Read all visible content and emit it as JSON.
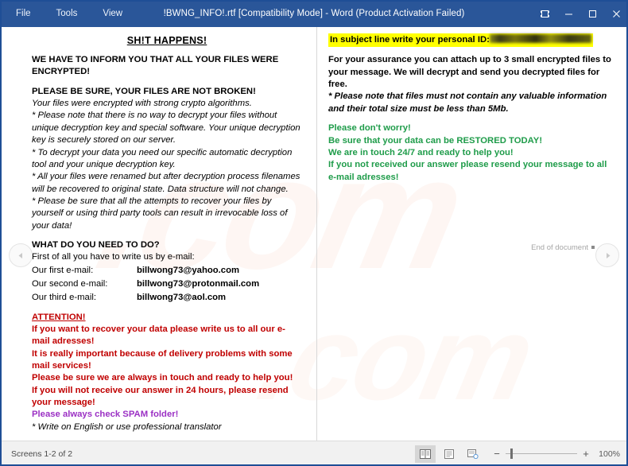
{
  "titlebar": {
    "menu": [
      {
        "label": "File",
        "name": "menu-file"
      },
      {
        "label": "Tools",
        "name": "menu-tools"
      },
      {
        "label": "View",
        "name": "menu-view"
      }
    ],
    "title": "!BWNG_INFO!.rtf [Compatibility Mode] - Word (Product Activation Failed)",
    "controls": {
      "ribbon_options": "ribbon-display-options",
      "minimize": "minimize",
      "maximize": "maximize",
      "close": "close"
    },
    "background_color": "#2a5699"
  },
  "document": {
    "left_page": {
      "heading": "SH!T HAPPENS!",
      "line_inform": "WE HAVE TO INFORM YOU THAT ALL YOUR FILES WERE ENCRYPTED!",
      "line_not_broken": "PLEASE BE SURE, YOUR FILES ARE NOT BROKEN!",
      "para_strong_crypto": "Your files were encrypted with strong crypto algorithms.",
      "para_no_way": "* Please note that there is no way to decrypt your files without unique decryption key and special software. Your unique decryption key is securely stored on our server.",
      "para_tool": "* To decrypt your data you need our specific automatic decryption tool and your unique decryption key.",
      "para_renamed": "* All your files were renamed but after decryption process filenames will be recovered to original state. Data structure will not change.",
      "para_third_party": "* Please be sure that all the attempts to recover your files by yourself or using third party tools can result in irrevocable loss of your data!",
      "what_do_you_need": "WHAT DO YOU NEED TO DO?",
      "first_of_all": "First of all you have to write us by e-mail:",
      "emails": [
        {
          "label": "Our first e-mail:",
          "value": "billwong73@yahoo.com"
        },
        {
          "label": "Our second e-mail:",
          "value": "billwong73@protonmail.com"
        },
        {
          "label": "Our third e-mail:",
          "value": "billwong73@aol.com"
        }
      ],
      "attention_heading": "ATTENTION!",
      "attention_lines": [
        "If you want to recover your data please write us to all our e-mail adresses!",
        "It is really important because of delivery problems with some mail services!",
        "Please be sure we are always in touch and ready to help you!",
        "If you will not receive our answer in 24 hours, please resend your message!"
      ],
      "spam_line": "Please always check SPAM folder!",
      "translator_line": "* Write on English or use professional translator"
    },
    "right_page": {
      "subject_line_label": "In subject line write your personal ID:",
      "personal_id": "",
      "assurance_para": "For your assurance you can attach up to 3 small encrypted files to your message. We will decrypt and send you decrypted files for free.",
      "note_para": "*      Please note that files must not contain any valuable information and their total size must be less than 5Mb.",
      "green_lines": [
        "Please don't worry!",
        "Be sure that your data can be RESTORED TODAY!",
        "We are in touch 24/7 and ready to help you!",
        "If you not received our answer please resend your message to all e-mail adresses!"
      ],
      "end_of_document": "End of document"
    },
    "watermark_text": ".com",
    "colors": {
      "red": "#c00000",
      "green": "#1f9c4a",
      "purple": "#9b30c4",
      "highlight": "#ffff00"
    }
  },
  "navigation": {
    "previous": "previous-page",
    "next": "next-page"
  },
  "statusbar": {
    "screens_label": "Screens 1-2 of 2",
    "views": [
      {
        "name": "read-mode-view",
        "active": true
      },
      {
        "name": "print-layout-view",
        "active": false
      },
      {
        "name": "web-layout-view",
        "active": false
      }
    ],
    "zoom_out": "−",
    "zoom_in": "+",
    "zoom_level": "100%"
  }
}
